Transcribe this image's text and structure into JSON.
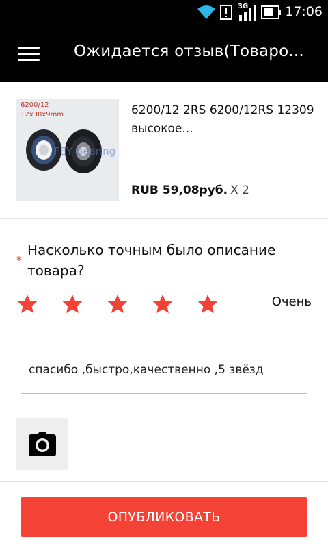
{
  "status_bar": {
    "time": "17:06",
    "network_label": "3G",
    "icons": [
      "wifi-icon",
      "alert-icon",
      "signal-icon",
      "battery-icon"
    ]
  },
  "app_bar": {
    "title": "Ожидается отзыв(Товаро...",
    "menu_icon": "hamburger-menu-icon"
  },
  "product": {
    "image_text_line1": "6200/12",
    "image_text_line2": "12x30x9mm",
    "image_watermark": "FBY Bearing",
    "name": "6200/12 2RS 6200/12RS 12309 высокое...",
    "price": "RUB 59,08руб.",
    "quantity": "X 2"
  },
  "rating_section": {
    "required_marker": "*",
    "question": "Насколько точным было описание товара?",
    "stars_filled": 5,
    "stars_total": 5,
    "rating_label": "Очень",
    "star_color": "#f44336"
  },
  "review": {
    "value": "спасибо ,быстро,качественно ,5 звёзд"
  },
  "photo": {
    "icon": "camera-icon"
  },
  "publish_button": {
    "label": "ОПУБЛИКОВАТЬ",
    "color": "#f44336"
  }
}
